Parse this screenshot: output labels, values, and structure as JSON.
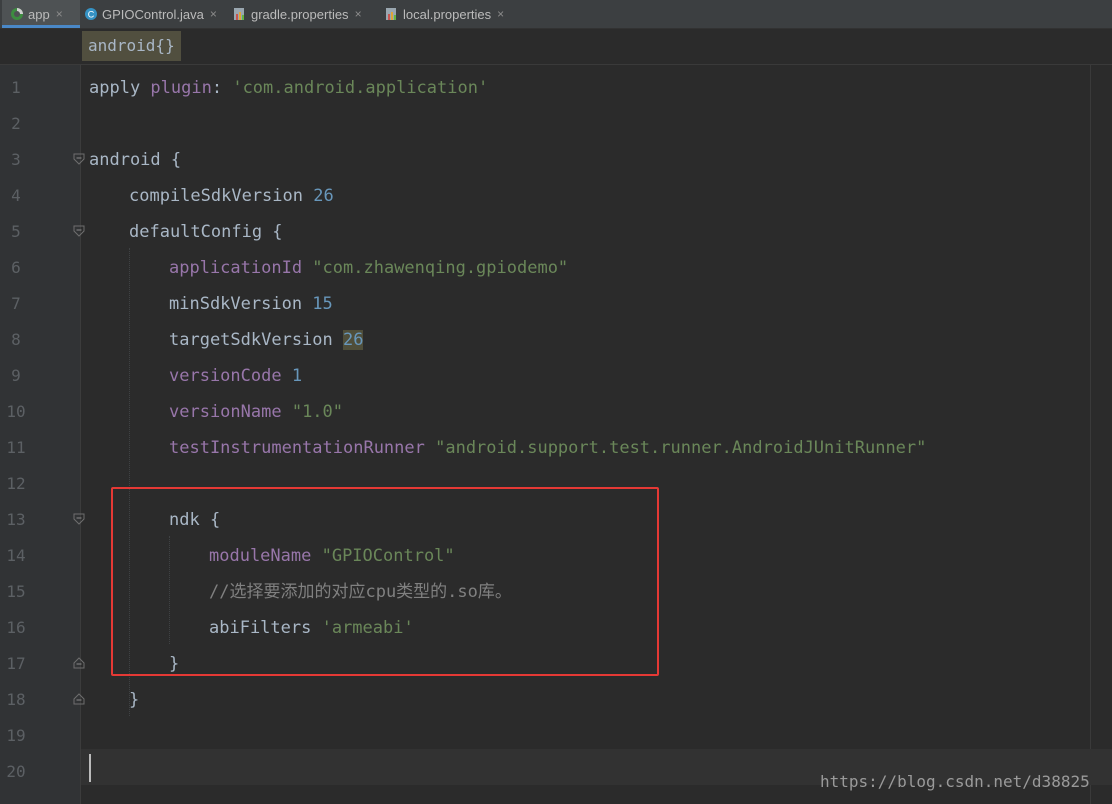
{
  "tabs": [
    {
      "label": "app",
      "icon": "gradle-app-icon"
    },
    {
      "label": "GPIOControl.java",
      "icon": "java-class-icon"
    },
    {
      "label": "gradle.properties",
      "icon": "properties-file-icon"
    },
    {
      "label": "local.properties",
      "icon": "properties-file-icon"
    }
  ],
  "tab_close": "×",
  "breadcrumb": "android{}",
  "line_numbers": [
    "1",
    "2",
    "3",
    "4",
    "5",
    "6",
    "7",
    "8",
    "9",
    "10",
    "11",
    "12",
    "13",
    "14",
    "15",
    "16",
    "17",
    "18",
    "19",
    "20"
  ],
  "code": {
    "l1_a": "apply ",
    "l1_b": "plugin",
    ": ": ": ",
    "l1_c": "'com.android.application'",
    "l3_a": "android {",
    "l4_a": "compileSdkVersion ",
    "l4_b": "26",
    "l5_a": "defaultConfig {",
    "l6_a": "applicationId ",
    "l6_b": "\"com.zhawenqing.gpiodemo\"",
    "l7_a": "minSdkVersion ",
    "l7_b": "15",
    "l8_a": "targetSdkVersion ",
    "l8_b": "26",
    "l9_a": "versionCode ",
    "l9_b": "1",
    "l10_a": "versionName ",
    "l10_b": "\"1.0\"",
    "l11_a": "testInstrumentationRunner ",
    "l11_b": "\"android.support.test.runner.AndroidJUnitRunner\"",
    "l13_a": "ndk {",
    "l14_a": "moduleName ",
    "l14_b": "\"GPIOControl\"",
    "l15_a": "//选择要添加的对应cpu类型的.so库。",
    "l16_a": "abiFilters ",
    "l16_b": "'armeabi'",
    "l17_a": "}",
    "l18_a": "}"
  },
  "watermark": "https://blog.csdn.net/d38825",
  "colors": {
    "highlight_box": "#e53935",
    "accent_tab": "#4a88c7"
  }
}
